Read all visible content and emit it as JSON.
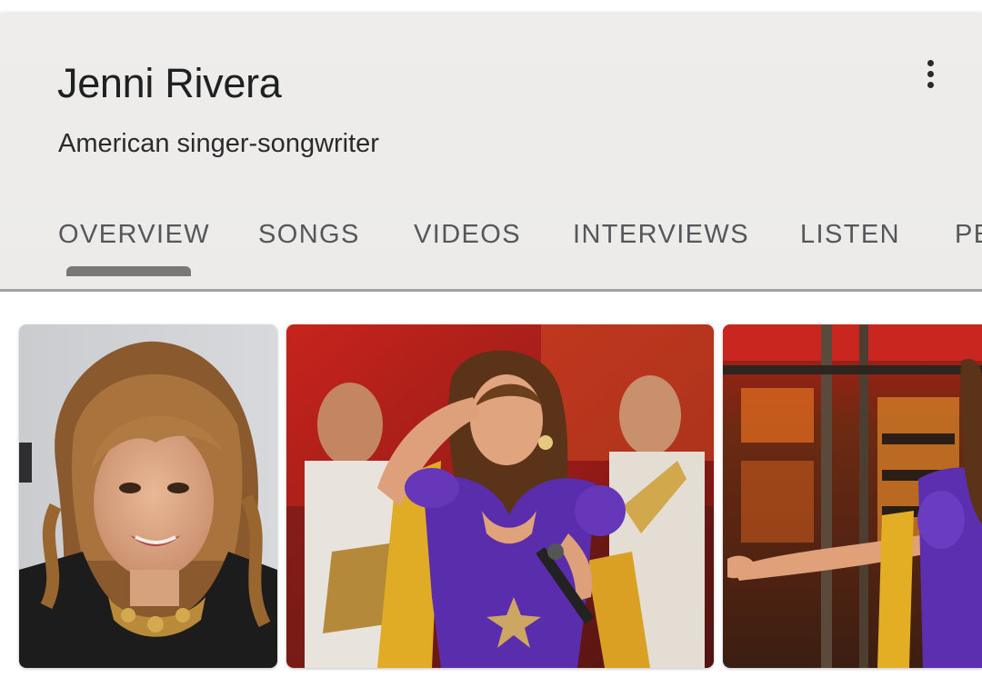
{
  "knowledge_panel": {
    "title": "Jenni Rivera",
    "subtitle": "American singer-songwriter",
    "more_options_icon": "more-vert-icon"
  },
  "tabs": [
    {
      "label": "OVERVIEW",
      "selected": true
    },
    {
      "label": "SONGS",
      "selected": false
    },
    {
      "label": "VIDEOS",
      "selected": false
    },
    {
      "label": "INTERVIEWS",
      "selected": false
    },
    {
      "label": "LISTEN",
      "selected": false
    },
    {
      "label": "PEOPLE ALSO SEARCH FOR",
      "selected": false
    }
  ],
  "images": [
    {
      "depicts": "portrait photo"
    },
    {
      "depicts": "stage performance with band"
    },
    {
      "depicts": "stage performance"
    }
  ],
  "colors": {
    "header_bg": "#edecea",
    "title_text": "#1f2022",
    "tab_text": "#55575a",
    "tab_indicator": "#7a7876",
    "divider": "#a4a2a0",
    "dress_purple": "#5a2dac",
    "shawl_yellow": "#e0ab25",
    "stage_red": "#b2231b"
  }
}
